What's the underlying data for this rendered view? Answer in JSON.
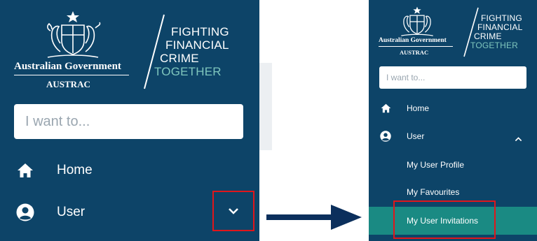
{
  "left": {
    "government_name": "Australian Government",
    "agency": "AUSTRAC",
    "tagline": [
      "FIGHTING",
      "FINANCIAL",
      "CRIME"
    ],
    "tagline_accent": "TOGETHER",
    "search_placeholder": "I want to...",
    "nav": [
      {
        "label": "Home",
        "icon": "home-icon"
      },
      {
        "label": "User",
        "icon": "user-circle-icon"
      }
    ],
    "expand_icon": "chevron-down-icon"
  },
  "right": {
    "government_name": "Australian Government",
    "agency": "AUSTRAC",
    "tagline": [
      "FIGHTING",
      "FINANCIAL",
      "CRIME"
    ],
    "tagline_accent": "TOGETHER",
    "search_placeholder": "I want to...",
    "nav": [
      {
        "label": "Home",
        "icon": "home-icon"
      },
      {
        "label": "User",
        "icon": "user-circle-icon"
      }
    ],
    "collapse_icon": "chevron-up-icon",
    "submenu": [
      {
        "label": "My User Profile",
        "active": false
      },
      {
        "label": "My Favourites",
        "active": false
      },
      {
        "label": "My User Invitations",
        "active": true
      }
    ]
  },
  "colors": {
    "panel_bg": "#0d4468",
    "accent_teal": "#7fc6bd",
    "active_item": "#1a8a83",
    "highlight_red": "#e0161b",
    "arrow": "#0b2f5c"
  }
}
